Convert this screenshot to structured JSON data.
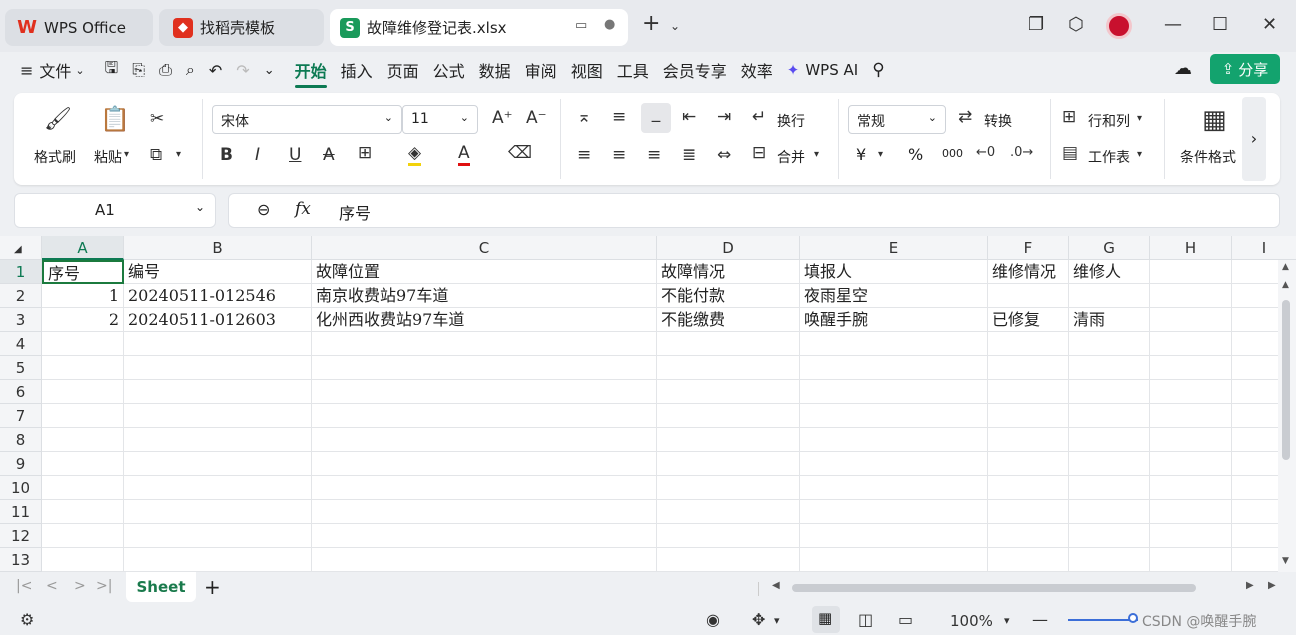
{
  "tabs": [
    {
      "label": "WPS Office"
    },
    {
      "label": "找稻壳模板"
    },
    {
      "label": "故障维修登记表.xlsx"
    }
  ],
  "menu": {
    "file": "文件",
    "items": [
      "开始",
      "插入",
      "页面",
      "公式",
      "数据",
      "审阅",
      "视图",
      "工具",
      "会员专享",
      "效率"
    ],
    "ai": "WPS AI",
    "share": "分享"
  },
  "ribbon": {
    "format_painter": "格式刷",
    "paste": "粘贴",
    "font_name": "宋体",
    "font_size": "11",
    "wrap": "换行",
    "merge": "合并",
    "number_format": "常规",
    "convert": "转换",
    "rows_cols": "行和列",
    "worksheet": "工作表",
    "cond_format": "条件格式",
    "currency": "¥",
    "percent": "%",
    "thousand": "000"
  },
  "formula_bar": {
    "cell_ref": "A1",
    "fx": "fx",
    "content": "序号"
  },
  "columns": [
    "A",
    "B",
    "C",
    "D",
    "E",
    "F",
    "G",
    "H",
    "I"
  ],
  "rows": [
    "1",
    "2",
    "3",
    "4",
    "5",
    "6",
    "7",
    "8",
    "9",
    "10",
    "11",
    "12",
    "13"
  ],
  "cells": {
    "r1": {
      "a": "序号",
      "b": "编号",
      "c": "故障位置",
      "d": "故障情况",
      "e": "填报人",
      "f": "维修情况",
      "g": "维修人"
    },
    "r2": {
      "a": "1",
      "b": "20240511-012546",
      "c": "南京收费站97车道",
      "d": "不能付款",
      "e": "夜雨星空",
      "f": "",
      "g": ""
    },
    "r3": {
      "a": "2",
      "b": "20240511-012603",
      "c": "化州西收费站97车道",
      "d": "不能缴费",
      "e": "唤醒手腕",
      "f": "已修复",
      "g": "清雨"
    }
  },
  "sheet_tab": "Sheet",
  "status": {
    "zoom": "100%",
    "watermark": "CSDN @唤醒手腕"
  },
  "colors": {
    "accent": "#0d7a53",
    "wps_red": "#e0301e",
    "sheet_green": "#1a9a5b",
    "share_bg": "#13a36e"
  }
}
